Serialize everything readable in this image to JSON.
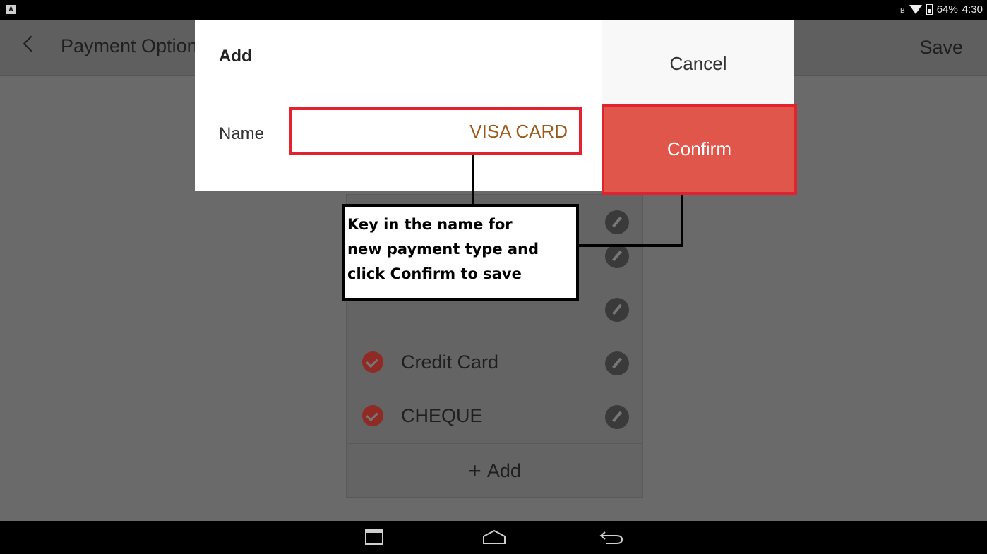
{
  "status_bar": {
    "battery": "64%",
    "time": "4:30"
  },
  "app_bar": {
    "title": "Payment Options",
    "save_label": "Save"
  },
  "payment_list": {
    "items": [
      {
        "label": ""
      },
      {
        "label": ""
      },
      {
        "label": "Credit Card"
      },
      {
        "label": "CHEQUE"
      }
    ],
    "add_label": "Add"
  },
  "dialog": {
    "title": "Add",
    "cancel_label": "Cancel",
    "confirm_label": "Confirm",
    "name_label": "Name",
    "name_value": "VISA CARD"
  },
  "annotation": {
    "line1": "Key in the name for",
    "line2": "new payment type and",
    "line3": "click Confirm to save"
  },
  "colors": {
    "highlight_border": "#e3222f",
    "confirm_fill": "#e0564b",
    "input_text": "#9b5a1a"
  }
}
